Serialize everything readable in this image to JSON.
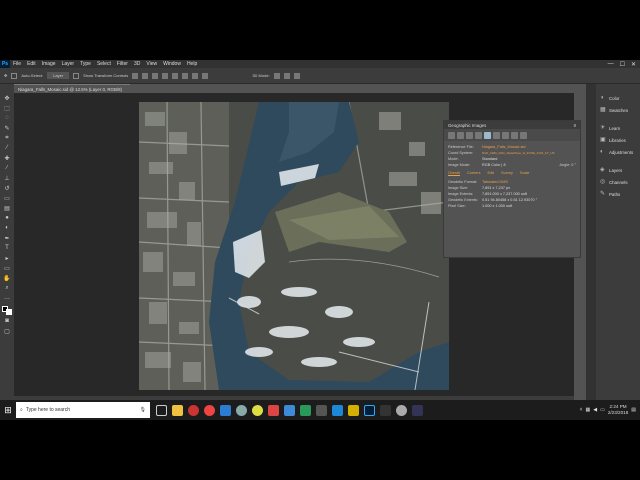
{
  "app": {
    "name": "Ps",
    "menu": [
      "File",
      "Edit",
      "Image",
      "Layer",
      "Type",
      "Select",
      "Filter",
      "3D",
      "View",
      "Window",
      "Help"
    ],
    "window_controls": [
      "—",
      "☐",
      "✕"
    ]
  },
  "options": {
    "auto_select": "Auto-Select:",
    "layer_value": "Layer",
    "transform_controls": "Show Transform Controls",
    "mode_3d": "3D Mode:"
  },
  "document": {
    "tab_title": "Niagara_Falls_Mosaic.sid @ 12.5% (Layer 0, RGB/8)",
    "zoom": "12.5%",
    "doc_size": "Doc: 189.0M/189.0M"
  },
  "right_panel": {
    "group1": [
      "Color",
      "Swatches"
    ],
    "group2": [
      "Learn",
      "Libraries",
      "Adjustments"
    ],
    "group3": [
      "Layers",
      "Channels",
      "Paths"
    ]
  },
  "geo_panel": {
    "title": "Geographic Images",
    "rows": [
      {
        "k": "Reference File:",
        "v": "Niagara_Falls_Mosaic.sid",
        "orange": true
      },
      {
        "k": "Coord System:",
        "v": "NAD_1983_2011_StatePlane_N_ZONE_3104_FT_US",
        "orange": true
      },
      {
        "k": "Mode:",
        "v": "Standard",
        "orange": false
      },
      {
        "k": "Image Mode:",
        "v": "RGB Color | 8",
        "orange": false
      }
    ],
    "angle": "Angle: 0 °",
    "segments": [
      "Overall",
      "Corners",
      "Edit",
      "Survey",
      "Scale"
    ],
    "rows2": [
      {
        "k": "Geodetic Format:",
        "v": "Tabulated DMS",
        "orange": true
      },
      {
        "k": "Image Size:",
        "v": "7,891 x 7,237 px",
        "orange": false
      },
      {
        "k": "Image Extents:",
        "v": "7,891.000 x 7,237.000 usft",
        "orange": false
      },
      {
        "k": "Geodetic Extents:",
        "v": "0.51 94.80458 x 0.51 12.93070 °",
        "orange": false
      },
      {
        "k": "Pixel Size:",
        "v": "1.000 x 1.000 usft",
        "orange": false
      }
    ]
  },
  "taskbar": {
    "search_placeholder": "Type here to search",
    "time": "2:24 PM",
    "date": "2/23/2018"
  },
  "colors": {
    "accent": "#e8a04a",
    "ps_blue": "#31a8ff",
    "water": "#2f4a5c",
    "foam": "#e8eef2"
  }
}
